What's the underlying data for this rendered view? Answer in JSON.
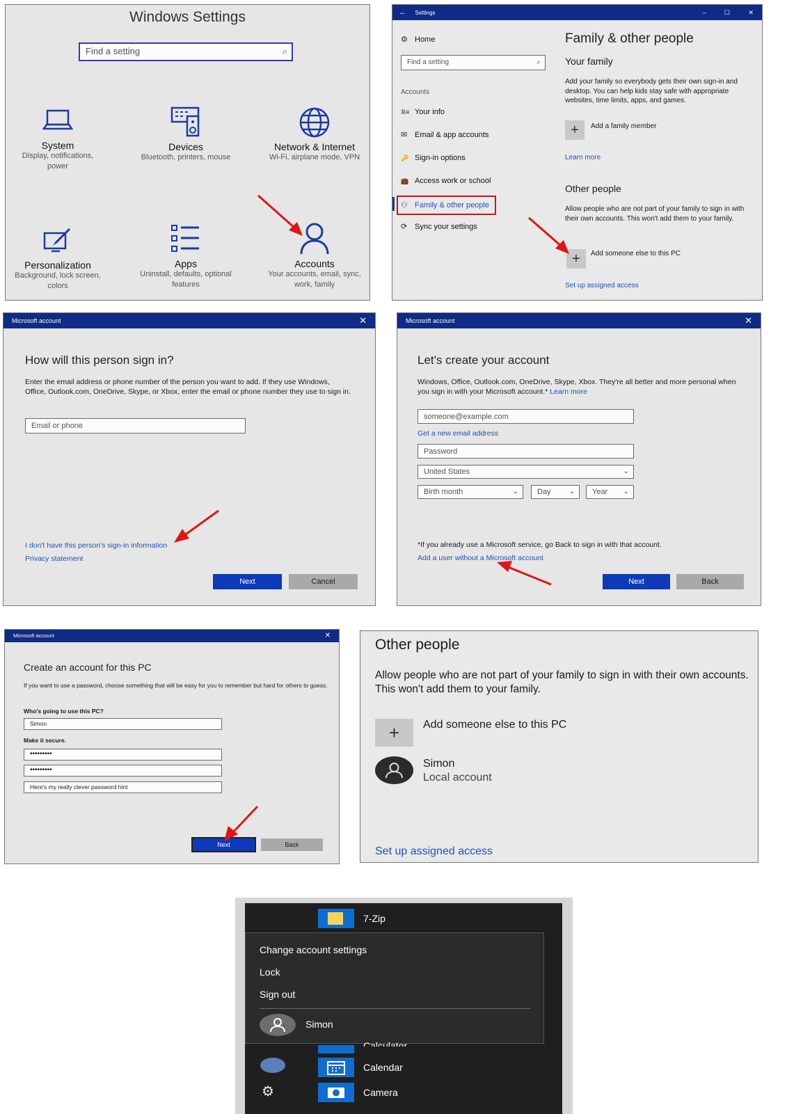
{
  "p1": {
    "title": "Windows Settings",
    "search_placeholder": "Find a setting",
    "tiles": [
      {
        "icon": "laptop-icon",
        "title": "System",
        "sub": "Display, notifications, power"
      },
      {
        "icon": "keyboard-speaker-icon",
        "title": "Devices",
        "sub": "Bluetooth, printers, mouse"
      },
      {
        "icon": "globe-icon",
        "title": "Network & Internet",
        "sub": "Wi-Fi, airplane mode, VPN"
      },
      {
        "icon": "paint-brush-icon",
        "title": "Personalization",
        "sub": "Background, lock screen, colors"
      },
      {
        "icon": "list-icon",
        "title": "Apps",
        "sub": "Uninstall, defaults, optional features"
      },
      {
        "icon": "person-icon",
        "title": "Accounts",
        "sub": "Your accounts, email, sync, work, family"
      }
    ]
  },
  "p2": {
    "window_title": "Settings",
    "home": "Home",
    "search_placeholder": "Find a setting",
    "section": "Accounts",
    "nav": [
      {
        "icon": "ℝ≡",
        "label": "Your info"
      },
      {
        "icon": "✉",
        "label": "Email & app accounts"
      },
      {
        "icon": "🔑",
        "label": "Sign-in options"
      },
      {
        "icon": "💼",
        "label": "Access work or school"
      },
      {
        "icon": "⚇",
        "label": "Family & other people"
      },
      {
        "icon": "⟳",
        "label": "Sync your settings"
      }
    ],
    "heading": "Family & other people",
    "your_family": "Your family",
    "family_desc": "Add your family so everybody gets their own sign-in and desktop. You can help kids stay safe with appropriate websites, time limits, apps, and games.",
    "add_family": "Add a family member",
    "learn_more": "Learn more",
    "other_people": "Other people",
    "other_desc": "Allow people who are not part of your family to sign in with their own accounts. This won't add them to your family.",
    "add_someone": "Add someone else to this PC",
    "assigned": "Set up assigned access"
  },
  "p3": {
    "window_title": "Microsoft account",
    "heading": "How will this person sign in?",
    "desc": "Enter the email address or phone number of the person you want to add. If they use Windows, Office, Outlook.com, OneDrive, Skype, or Xbox, enter the email or phone number they use to sign in.",
    "placeholder": "Email or phone",
    "no_info": "I don't have this person's sign-in information",
    "privacy": "Privacy statement",
    "next": "Next",
    "cancel": "Cancel"
  },
  "p4": {
    "window_title": "Microsoft account",
    "heading": "Let's create your account",
    "desc": "Windows, Office, Outlook.com, OneDrive, Skype, Xbox. They're all better and more personal when you sign in with your Microsoft account.*",
    "learn_more": "Learn more",
    "email_placeholder": "someone@example.com",
    "new_email": "Get a new email address",
    "password_placeholder": "Password",
    "country": "United States",
    "birth_month": "Birth month",
    "day": "Day",
    "year": "Year",
    "note": "*If you already use a Microsoft service, go Back to sign in with that account.",
    "no_ms_account": "Add a user without a Microsoft account",
    "next": "Next",
    "back": "Back"
  },
  "p5": {
    "window_title": "Microsoft account",
    "heading": "Create an account for this PC",
    "desc": "If you want to use a password, choose something that will be easy for you to remember but hard for others to guess.",
    "who_label": "Who's going to use this PC?",
    "username": "Simon",
    "secure_label": "Make it secure.",
    "password": "•••••••••",
    "password_confirm": "•••••••••",
    "hint": "Here's my really clever password hint",
    "next": "Next",
    "back": "Back"
  },
  "p6": {
    "heading": "Other people",
    "desc": "Allow people who are not part of your family to sign in with their own accounts. This won't add them to your family.",
    "add_someone": "Add someone else to this PC",
    "user_name": "Simon",
    "user_type": "Local account",
    "assigned": "Set up assigned access"
  },
  "p7": {
    "app_top": "7-Zip",
    "menu": [
      "Change account settings",
      "Lock",
      "Sign out"
    ],
    "user": "Simon",
    "apps": [
      "Calculator",
      "Calendar",
      "Camera"
    ]
  },
  "colors": {
    "accent": "#0c3ab8",
    "title_bar": "#0f2b86",
    "link": "#1b53b8",
    "highlight_box": "#d4101b",
    "arrow": "#e01414",
    "start_bg": "#1f1f1f"
  }
}
